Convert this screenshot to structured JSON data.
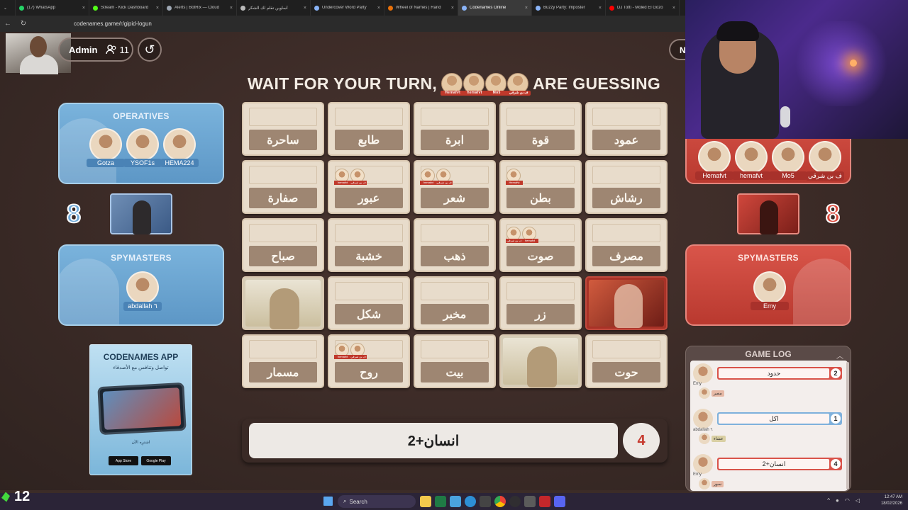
{
  "browser": {
    "tabs": [
      {
        "title": "(17) WhatsApp",
        "color": "#25d366"
      },
      {
        "title": "Stream - Kick Dashboard",
        "color": "#53fc18"
      },
      {
        "title": "Alerts | BotRix — Cloud",
        "color": "#9ea7b3"
      },
      {
        "title": "أساوين تقلم لك الشكر",
        "color": "#bbbbbb"
      },
      {
        "title": "Undercover Word Party",
        "color": "#8ab4f8"
      },
      {
        "title": "Wheel of Names | Rand",
        "color": "#e8710a"
      },
      {
        "title": "Codenames Online",
        "color": "#8ab4f8",
        "active": true
      },
      {
        "title": "Buzzy Party: Imposter",
        "color": "#8ab4f8"
      },
      {
        "title": "DJ Totti - Moled El Gozo",
        "color": "#ff0000"
      }
    ],
    "url": "codenames.game/r/gipid-logun"
  },
  "header": {
    "admin_label": "Admin",
    "player_count": "11",
    "next_label": "Ne",
    "headline_left": "WAIT FOR YOUR TURN,",
    "headline_right": "ARE GUESSING",
    "guessers": [
      "Hemafvt",
      "hemafvt",
      "Mo5",
      "ف بن شرقي"
    ]
  },
  "blue_team": {
    "operatives_title": "OPERATIVES",
    "operatives": [
      "Gotza",
      "YSOF1s",
      "HEMA224"
    ],
    "score": "8",
    "spymasters_title": "SPYMASTERS",
    "spymasters": [
      "abdallah ٦"
    ]
  },
  "red_team": {
    "operatives": [
      "Hemafvt",
      "hemafvt",
      "Mo5",
      "ف بن شرقي"
    ],
    "score": "8",
    "spymasters_title": "SPYMASTERS",
    "spymasters": [
      "Emy"
    ]
  },
  "cards": [
    {
      "word": "ساحرة",
      "state": "hidden",
      "voters": []
    },
    {
      "word": "طابع",
      "state": "hidden",
      "voters": []
    },
    {
      "word": "ابرة",
      "state": "hidden",
      "voters": []
    },
    {
      "word": "قوة",
      "state": "hidden",
      "voters": []
    },
    {
      "word": "عمود",
      "state": "hidden",
      "voters": []
    },
    {
      "word": "صفارة",
      "state": "hidden",
      "voters": []
    },
    {
      "word": "عبور",
      "state": "hidden",
      "voters": [
        "hemafvt",
        "ف بن شرقي"
      ]
    },
    {
      "word": "شعر",
      "state": "hidden",
      "voters": [
        "hemafvt",
        "ف بن شرقي"
      ]
    },
    {
      "word": "بطن",
      "state": "hidden",
      "voters": [
        "Hemafvt"
      ]
    },
    {
      "word": "رشاش",
      "state": "hidden",
      "voters": []
    },
    {
      "word": "صباح",
      "state": "hidden",
      "voters": []
    },
    {
      "word": "خشبة",
      "state": "hidden",
      "voters": []
    },
    {
      "word": "ذهب",
      "state": "hidden",
      "voters": []
    },
    {
      "word": "صوت",
      "state": "hidden",
      "voters": [
        "ف بن شرقي",
        "hemafvt"
      ]
    },
    {
      "word": "مصرف",
      "state": "hidden",
      "voters": []
    },
    {
      "word": "",
      "state": "neutral",
      "voters": []
    },
    {
      "word": "شكل",
      "state": "hidden",
      "voters": []
    },
    {
      "word": "مخبر",
      "state": "hidden",
      "voters": []
    },
    {
      "word": "زر",
      "state": "hidden",
      "voters": []
    },
    {
      "word": "",
      "state": "red",
      "voters": []
    },
    {
      "word": "مسمار",
      "state": "hidden",
      "voters": []
    },
    {
      "word": "روح",
      "state": "hidden",
      "voters": [
        "hemafvt",
        "ف بن شرقي"
      ]
    },
    {
      "word": "بيت",
      "state": "hidden",
      "voters": []
    },
    {
      "word": "",
      "state": "neutral",
      "voters": []
    },
    {
      "word": "حوت",
      "state": "hidden",
      "voters": []
    }
  ],
  "clue": {
    "word": "انسان+2",
    "number": "4"
  },
  "promo": {
    "title": "CODENAMES APP",
    "subtitle": "تواصل وتنافس مع الأصدقاء",
    "cta": "اشترِه الآن",
    "app_store": "App Store",
    "google_play": "Google Play"
  },
  "game_log": {
    "title": "GAME LOG",
    "entries": [
      {
        "player": "Emy",
        "team": "red",
        "clue": "حدود",
        "number": "2",
        "guess": "مصر"
      },
      {
        "player": "abdallah ٦",
        "team": "blue",
        "clue": "اكل",
        "number": "1",
        "guess": "عشاء"
      },
      {
        "player": "Emy",
        "team": "red",
        "clue": "انسان+2",
        "number": "4",
        "guess": "سور"
      }
    ]
  },
  "taskbar": {
    "counter": "12",
    "search_placeholder": "Search",
    "time": "12:47 AM",
    "date": "18/02/2026"
  }
}
